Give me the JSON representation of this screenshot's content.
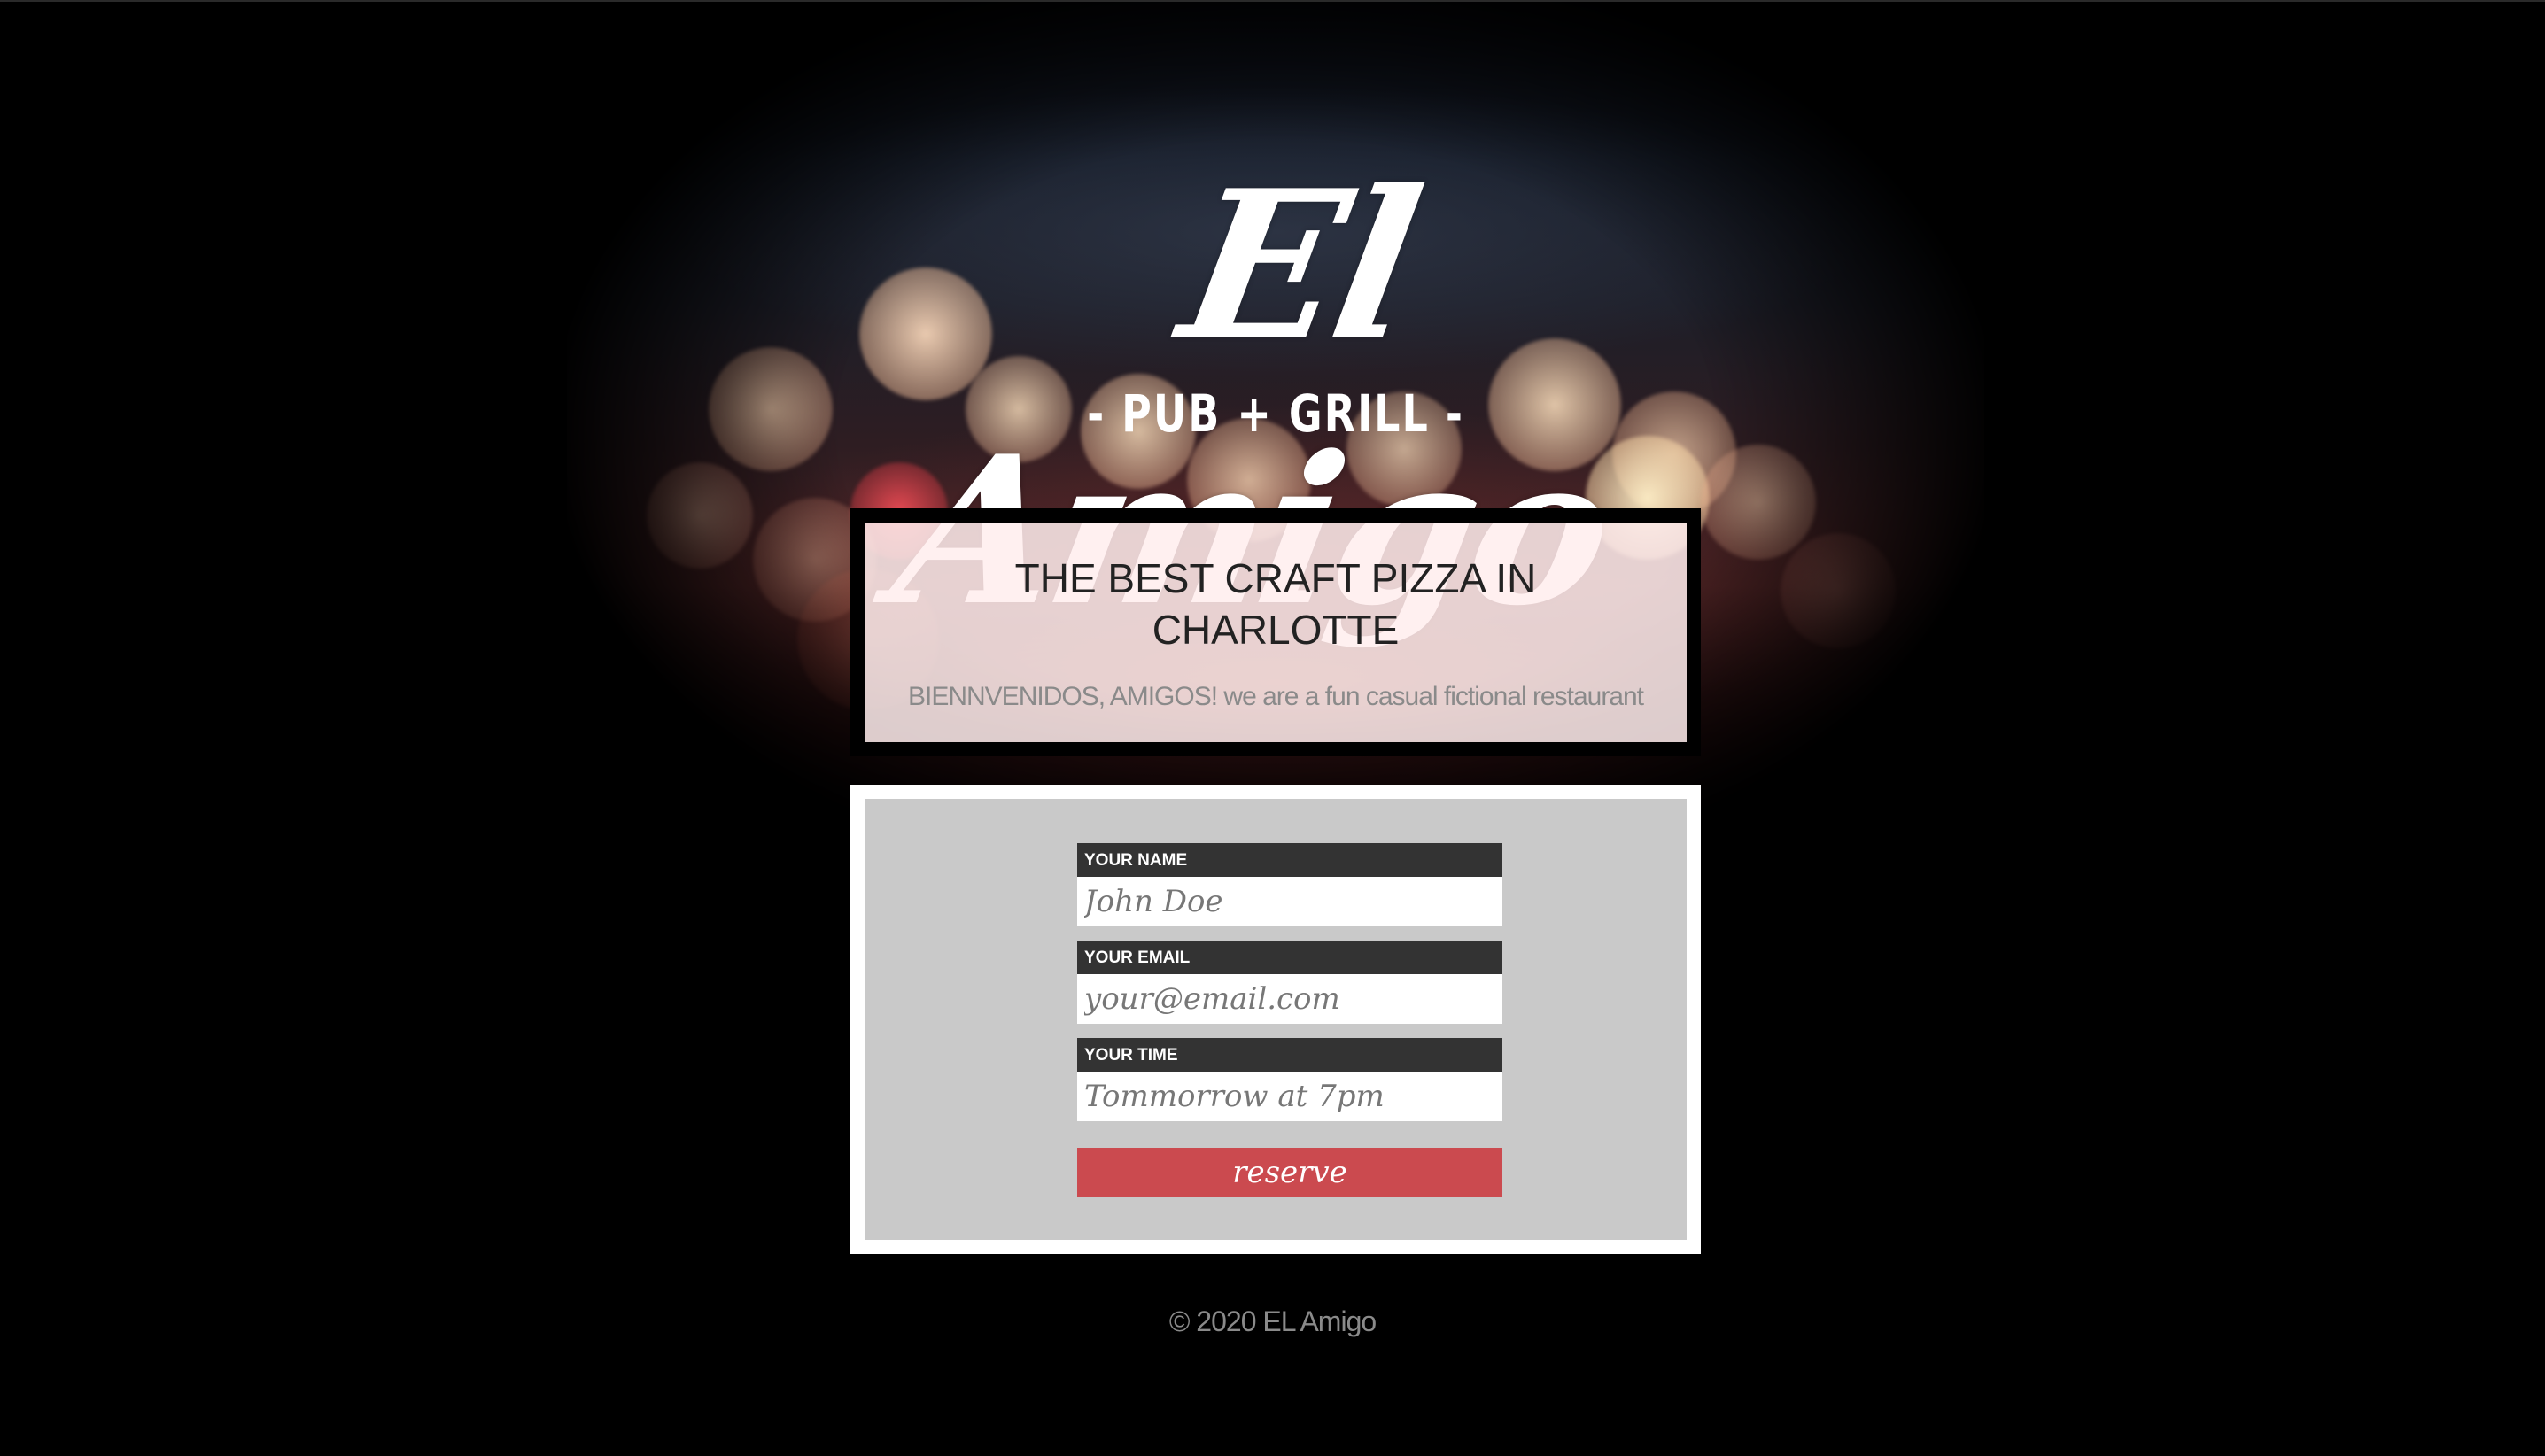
{
  "colors": {
    "page_background": "#000000",
    "accent_button": "#cb4a4f",
    "label_background": "#333333",
    "form_panel": "#c9c9c9",
    "intro_box": "#ffeeee"
  },
  "header": {
    "logo_script": "El Amigo",
    "logo_subtitle": "- PUB + GRILL -"
  },
  "intro": {
    "title": "THE BEST CRAFT PIZZA IN CHARLOTTE",
    "text": "BIENNVENIDOS, AMIGOS! we are a fun casual fictional restaurant"
  },
  "form": {
    "fields": [
      {
        "label": "YOUR NAME",
        "placeholder": "John Doe"
      },
      {
        "label": "YOUR EMAIL",
        "placeholder": "your@email.com"
      },
      {
        "label": "YOUR TIME",
        "placeholder": "Tommorrow at 7pm"
      }
    ],
    "submit_label": "reserve"
  },
  "footer": {
    "copyright": "© 2020 EL Amigo"
  }
}
